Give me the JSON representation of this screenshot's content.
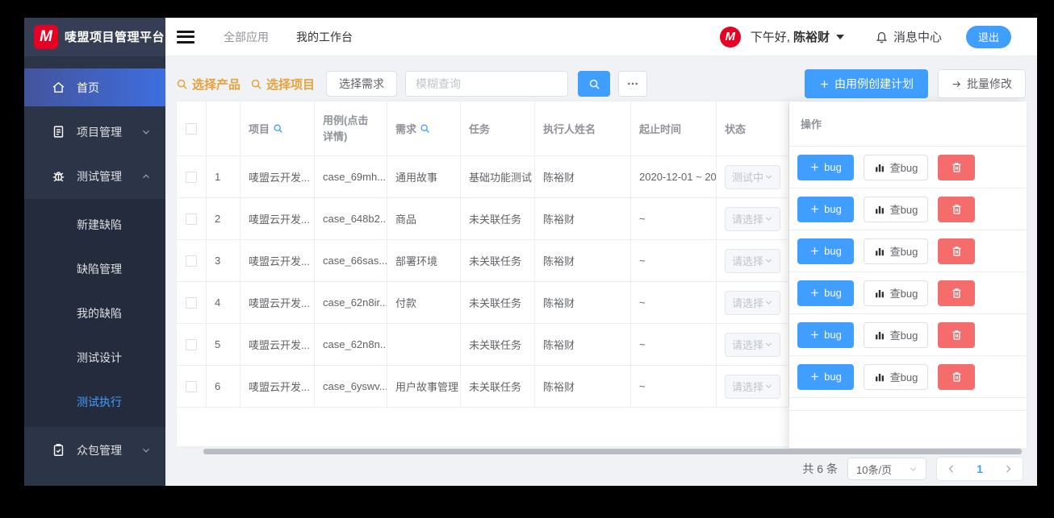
{
  "colors": {
    "accent": "#409eff",
    "danger": "#f56c6c",
    "warning": "#e6a23c",
    "logo_red": "#e60023",
    "sidebar_bg": "#2c3447"
  },
  "header": {
    "logo_letter": "M",
    "app_title": "唛盟项目管理平台",
    "nav": [
      {
        "label": "全部应用"
      },
      {
        "label": "我的工作台"
      }
    ],
    "greeting": "下午好,",
    "user_name": "陈裕财",
    "message_center": "消息中心",
    "logout_label": "退出",
    "avatar_letter": "M"
  },
  "sidebar": {
    "items": [
      {
        "label": "首页",
        "active": true
      },
      {
        "label": "项目管理"
      },
      {
        "label": "测试管理",
        "expanded": true
      },
      {
        "label": "众包管理"
      }
    ],
    "test_children": [
      {
        "label": "新建缺陷"
      },
      {
        "label": "缺陷管理"
      },
      {
        "label": "我的缺陷"
      },
      {
        "label": "测试设计"
      },
      {
        "label": "测试执行",
        "active": true
      }
    ]
  },
  "toolbar": {
    "select_product": "选择产品",
    "select_project": "选择项目",
    "select_requirement": "选择需求",
    "search_placeholder": "模糊查询",
    "create_plan": "由用例创建计划",
    "batch_edit": "批量修改"
  },
  "table": {
    "columns": {
      "project": "项目",
      "case": "用例(点击详情)",
      "requirement": "需求",
      "task": "任务",
      "executor": "执行人姓名",
      "dates": "起止时间",
      "status": "状态",
      "actions": "操作"
    },
    "rows": [
      {
        "index": "1",
        "project": "唛盟云开发...",
        "case": "case_69mh...",
        "requirement": "通用故事",
        "task": "基础功能测试",
        "executor": "陈裕财",
        "dates": "2020-12-01 ~ 20",
        "status": "测试中"
      },
      {
        "index": "2",
        "project": "唛盟云开发...",
        "case": "case_648b2...",
        "requirement": "商品",
        "task": "未关联任务",
        "executor": "陈裕财",
        "dates": "~",
        "status": "请选择"
      },
      {
        "index": "3",
        "project": "唛盟云开发...",
        "case": "case_66sas...",
        "requirement": "部署环境",
        "task": "未关联任务",
        "executor": "陈裕财",
        "dates": "~",
        "status": "请选择"
      },
      {
        "index": "4",
        "project": "唛盟云开发...",
        "case": "case_62n8ir...",
        "requirement": "付款",
        "task": "未关联任务",
        "executor": "陈裕财",
        "dates": "~",
        "status": "请选择"
      },
      {
        "index": "5",
        "project": "唛盟云开发...",
        "case": "case_62n8n...",
        "requirement": "",
        "task": "未关联任务",
        "executor": "陈裕财",
        "dates": "~",
        "status": "请选择"
      },
      {
        "index": "6",
        "project": "唛盟云开发...",
        "case": "case_6yswv...",
        "requirement": "用户故事管理",
        "task": "未关联任务",
        "executor": "陈裕财",
        "dates": "~",
        "status": "请选择"
      }
    ],
    "actions": {
      "add_bug": "bug",
      "view_bug": "查bug"
    }
  },
  "pagination": {
    "total": "共 6 条",
    "page_size": "10条/页",
    "current_page": "1"
  }
}
